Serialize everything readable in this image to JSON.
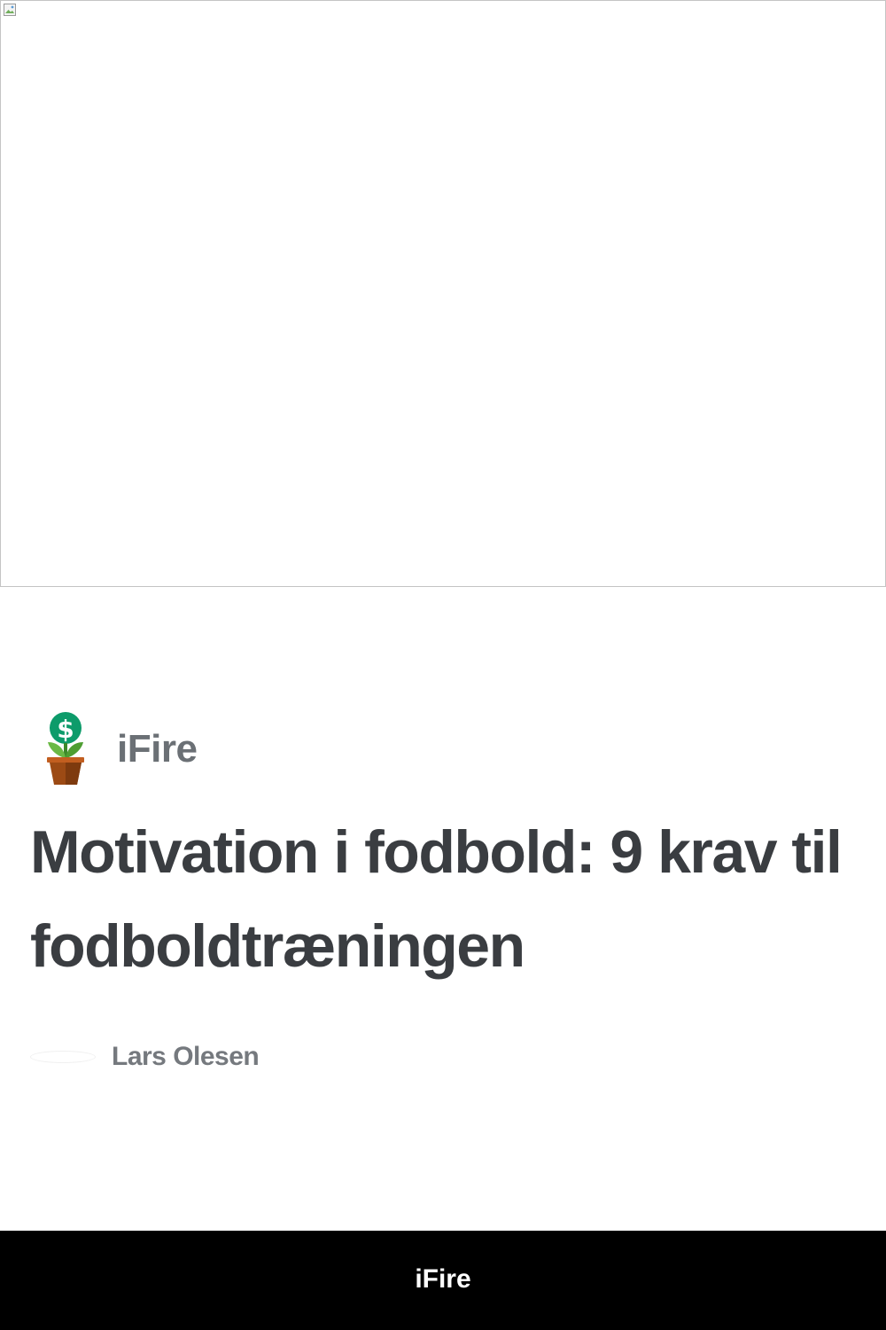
{
  "hero": {
    "image_icon": "broken-image-icon"
  },
  "brand": {
    "name": "iFire",
    "logo_icon": "money-plant-icon",
    "colors": {
      "coin": "#0d9b6a",
      "leaves": "#6ab945",
      "pot": "#9c4a14"
    }
  },
  "article": {
    "title": "Motivation i fodbold: 9 krav til fodboldtræningen",
    "author": "Lars Olesen"
  },
  "footer": {
    "text": "iFire",
    "background": "#000000"
  }
}
